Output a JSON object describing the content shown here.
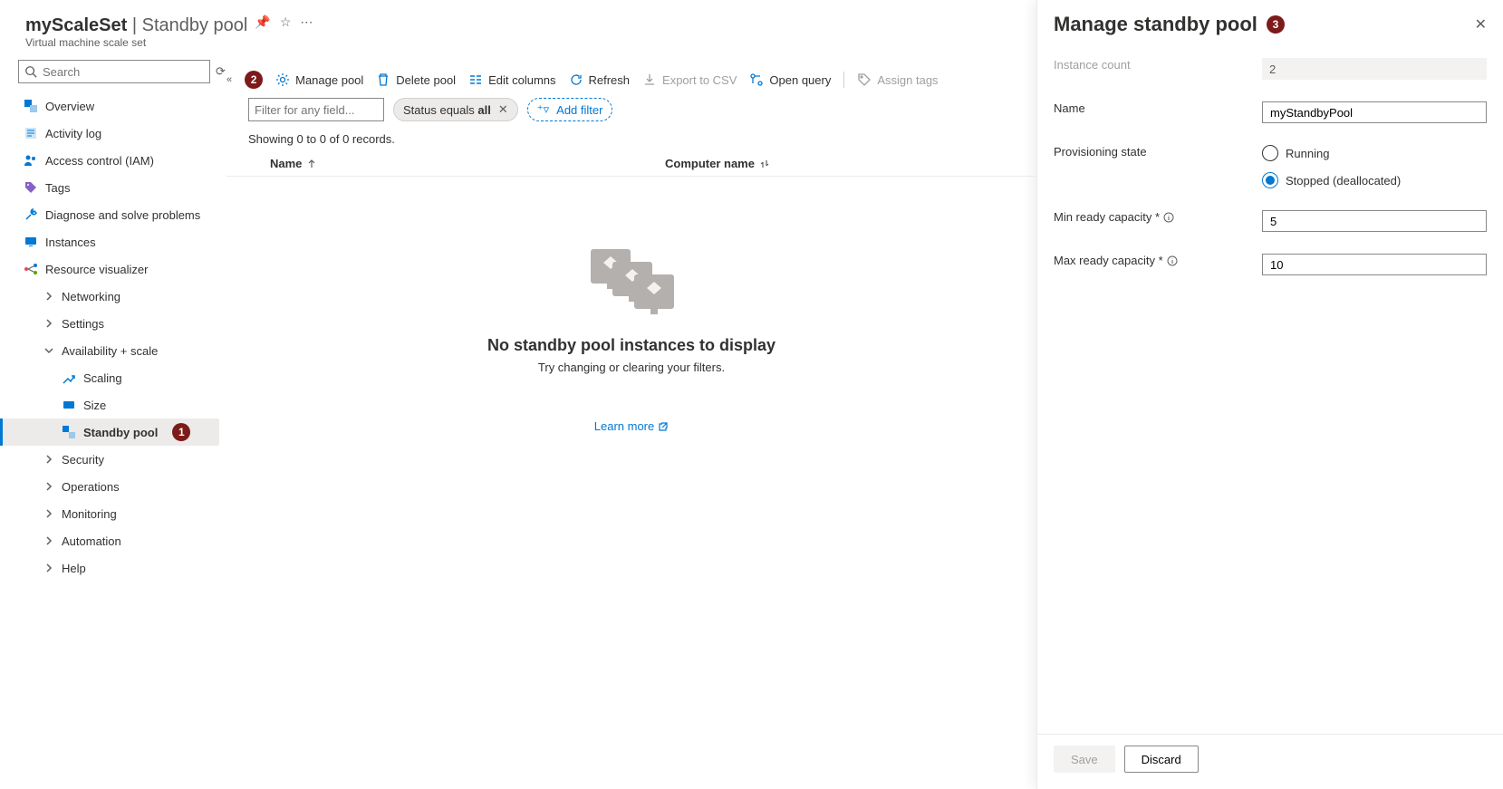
{
  "header": {
    "resource_name": "myScaleSet",
    "blade_title": "Standby pool",
    "subtitle": "Virtual machine scale set"
  },
  "search": {
    "placeholder": "Search"
  },
  "nav": {
    "overview": "Overview",
    "activity_log": "Activity log",
    "iam": "Access control (IAM)",
    "tags": "Tags",
    "diagnose": "Diagnose and solve problems",
    "instances": "Instances",
    "resource_visualizer": "Resource visualizer",
    "networking": "Networking",
    "settings": "Settings",
    "avail_scale": "Availability + scale",
    "scaling": "Scaling",
    "size": "Size",
    "standby_pool": "Standby pool",
    "security": "Security",
    "operations": "Operations",
    "monitoring": "Monitoring",
    "automation": "Automation",
    "help": "Help"
  },
  "callouts": {
    "one": "1",
    "two": "2",
    "three": "3"
  },
  "toolbar": {
    "manage_pool": "Manage pool",
    "delete_pool": "Delete pool",
    "edit_columns": "Edit columns",
    "refresh": "Refresh",
    "export_csv": "Export to CSV",
    "open_query": "Open query",
    "assign_tags": "Assign tags"
  },
  "filters": {
    "field_placeholder": "Filter for any field...",
    "status_pill_prefix": "Status equals ",
    "status_pill_value": "all",
    "add_filter": "Add filter"
  },
  "records_line": "Showing 0 to 0 of 0 records.",
  "table": {
    "col_name": "Name",
    "col_computer": "Computer name"
  },
  "empty": {
    "title": "No standby pool instances to display",
    "subtitle": "Try changing or clearing your filters.",
    "learn_more": "Learn more"
  },
  "panel": {
    "title": "Manage standby pool",
    "instance_count_label": "Instance count",
    "instance_count_value": "2",
    "name_label": "Name",
    "name_value": "myStandbyPool",
    "prov_state_label": "Provisioning state",
    "prov_running": "Running",
    "prov_stopped": "Stopped (deallocated)",
    "min_label": "Min ready capacity *",
    "min_value": "5",
    "max_label": "Max ready capacity *",
    "max_value": "10",
    "save": "Save",
    "discard": "Discard"
  }
}
